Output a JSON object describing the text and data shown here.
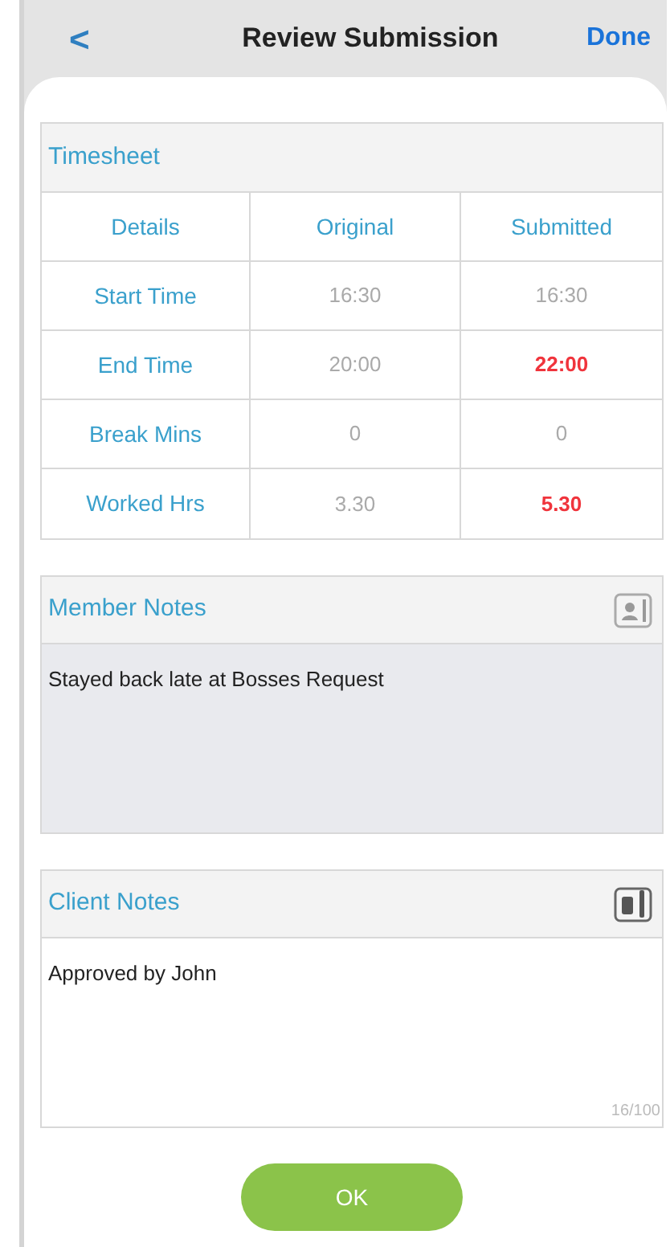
{
  "nav": {
    "back": "<",
    "title": "Review Submission",
    "done": "Done"
  },
  "timesheet": {
    "title": "Timesheet",
    "columns": [
      "Details",
      "Original",
      "Submitted"
    ],
    "rows": [
      {
        "label": "Start Time",
        "original": "16:30",
        "submitted": "16:30",
        "changed": false
      },
      {
        "label": "End Time",
        "original": "20:00",
        "submitted": "22:00",
        "changed": true
      },
      {
        "label": "Break Mins",
        "original": "0",
        "submitted": "0",
        "changed": false
      },
      {
        "label": "Worked Hrs",
        "original": "3.30",
        "submitted": "5.30",
        "changed": true
      }
    ]
  },
  "notes": [
    {
      "title": "Member Notes",
      "value": "Stayed back late at Bosses Request",
      "disabled": true
    },
    {
      "title": "Client Notes",
      "value": "Approved by John",
      "disabled": false,
      "counter": "16/100"
    }
  ],
  "ok_button": "OK"
}
